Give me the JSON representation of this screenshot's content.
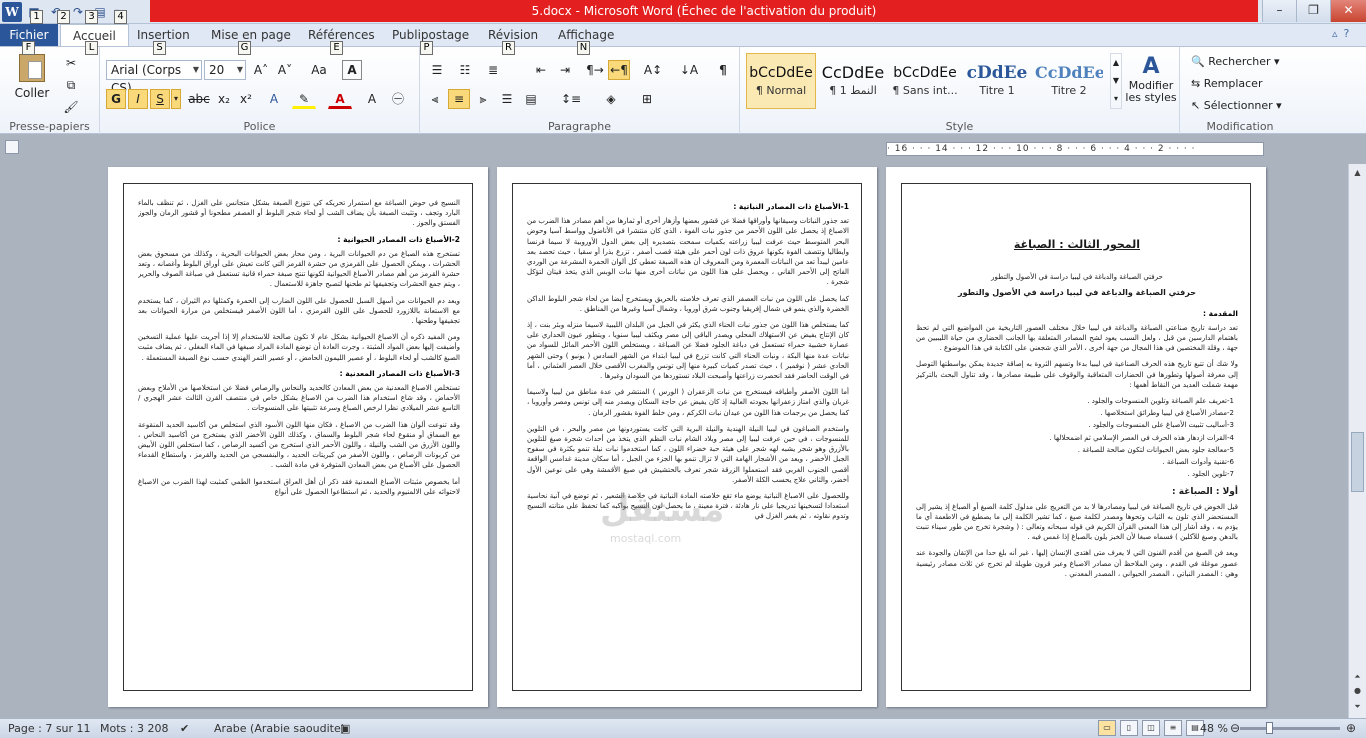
{
  "window": {
    "title": "5.docx  -  Microsoft Word (Échec de l'activation du produit)",
    "qat_keytips": [
      "1",
      "2",
      "3",
      "4"
    ]
  },
  "tabs": {
    "file": "Fichier",
    "items": [
      "Accueil",
      "Insertion",
      "Mise en page",
      "Références",
      "Publipostage",
      "Révision",
      "Affichage"
    ],
    "keytips": [
      "F",
      "L",
      "S",
      "G",
      "E",
      "P",
      "R",
      "N"
    ]
  },
  "ribbon": {
    "clipboard": {
      "label": "Presse-papiers",
      "paste": "Coller"
    },
    "font": {
      "label": "Police",
      "font_name": "Arial (Corps CS)",
      "font_size": "20",
      "bold": "G",
      "italic": "I",
      "underline": "S",
      "strike": "abc",
      "sub": "x₂",
      "sup": "x²",
      "grow": "A˄",
      "shrink": "A˅",
      "case": "Aa",
      "clear": "A"
    },
    "paragraph": {
      "label": "Paragraphe"
    },
    "styles": {
      "label": "Style",
      "items": [
        {
          "preview": "bCcDdEe",
          "name": "¶ Normal"
        },
        {
          "preview": "CcDdEe",
          "name": "¶ النمط 1"
        },
        {
          "preview": "bCcDdEe",
          "name": "¶ Sans int..."
        },
        {
          "preview": "cDdEe",
          "name": "Titre 1"
        },
        {
          "preview": "CcDdEe",
          "name": "Titre 2"
        }
      ],
      "change": "Modifier les styles"
    },
    "editing": {
      "label": "Modification",
      "find": "Rechercher",
      "replace": "Remplacer",
      "select": "Sélectionner"
    }
  },
  "ruler": {
    "ticks": "· 16 · · · 14 · · · 12 · · · 10 · · · 8 · · · 6 · · · 4 · · · 2 · · · ·"
  },
  "pages": {
    "left": {
      "p1": "النسيج في حوض الصباغة مع استمرار تحريكه كي تتوزع الصبغة بشكل متجانس على الغزل ، ثم تنظف بالماء البارد وتجف ، وتثبت الصبغة بأن يضاف الشب أو لحاء شجر البلوط أو العصفر مطحونا أو قشور الرمان والجوز الفستق والجوز .",
      "h1": "2-الأصباغ ذات المصادر الحيوانية :",
      "p2": "تستخرج هذه الصباغ من دم الحيوانات البرية ، ومن محار بعض الحيوانات البحرية ، وكذلك من مسحوق بعض الحشرات ، ويمكن الحصول على القرمزي من حشرة القرمز التي كانت تعيش على أوراق البلوط وأغصانه ، وتعد حشرة القرمز من أهم مصادر الأصباغ الحيوانية لكونها تنتج صبغة حمراء قانية تستعمل في صباغة الصوف والحرير ، ويتم جمع الحشرات وتجفيفها ثم طحنها لتصبح جاهزة للاستعمال .",
      "p3": "ويعد دم الحيوانات من أسهل السبل للحصول على اللون الضارب إلى الحمرة وكمثلها دم الثيران ، كما يستخدم مع الاستعانة باللازورد للحصول على اللون القرمزي ، أما اللون الأصفر فيستخلص من مرارة الحيوانات بعد تجفيفها وطحنها .",
      "p4": "ومن المفيد ذكره أن الاصباغ الحيوانية بشكل عام لا تكون صالحة للاستخدام إلا إذا أجريت عليها عملية التسخين وأضيفت إليها بعض المواد المثبتة ، وجرت العادة أن توضع المادة المراد صبغها في الماء المغلي ، ثم يضاف مثبت الصبغ كالشب أو لحاء البلوط ، أو عصير الليمون الحامض ، أو عصير التمر الهندي حسب نوع الصبغة المستعملة .",
      "h2": "3-الأصباغ ذات المصادر المعدنية :",
      "p5": "تستخلص الاصباغ المعدنية من بعض المعادن كالحديد والنحاس والرصاص فضلا عن استخلاصها من الأملاح وبعض الأحماض ، وقد شاع استخدام هذا الضرب من الاصباغ بشكل خاص في منتصف القرن الثالث عشر الهجري / التاسع عشر الميلادي نظرا لرخص الصباغ وسرعة تثبيتها على المنسوجات .",
      "p6": "وقد تنوعت ألوان هذا الضرب من الاصباغ ، فكان منها اللون الأسود الذي استخلص من أكاسيد الحديد المنقوعة مع السماق أو منقوع لحاء شجر البلوط والسماق ، وكذلك اللون الأخضر الذي يستخرج من أكاسيد النحاس ، واللون الأزرق من الشب والنيلة ، واللون الأحمر الذي استخرج من أكسيد الرصاص ، كما استخلص اللون الأبيض من كربونات الرصاص ، واللون الأصفر من كبريتات الحديد ، والبنفسجي من الحديد والقرمز ، واستطاع القدماء الحصول على الأصباغ من بعض المعادن المتوفرة في مادة الشب .",
      "p7": "أما بخصوص مثبتات الأصباغ المعدنية فقد ذكر أن أهل العراق استخدموا الطمي كمثبت لهذا الضرب من الاصباغ لاحتوائه على الالمنيوم والحديد ، ثم استطاعوا الحصول على أنواع"
    },
    "middle": {
      "h1": "1-الأصباغ ذات المصادر النباتية :",
      "p1": "تعد جذور النباتات وسيقانها وأوراقها فضلا عن قشور بعضها وأزهار أخرى أو ثمارها من أهم مصادر هذا الضرب من الاصباغ إذ يحصل على اللون الأحمر من جذور نبات الفوة ، الذي كان منتشرا في الأناضول وواسط آسيا وحوض البحر المتوسط حيث عرفت ليبيا زراعته بكميات سمحت بتصديره إلى بعض الدول الأوروبية لا سيما فرنسا وايطاليا وتتصف الفوة بكونها عروق ذات لون أحمر على هيئة قصب أصفر ، تزرع بذرا أو سقيا ، حيث تحصد بعد عامين ليبدأ تعد من النباتات المعمرة ومن المعروف أن هذه الصبغة تعطي كل ألوان الحمرة المشرعة من الوردي الفاتح إلى الأحمر القاني ، ويحصل على هذا اللون من نباتات أخرى منها نبات الوبس الذي يتخذ فيتان لتؤكل شجرة .",
      "p2": "كما يحصل على اللون من نبات العصفر الذي تعرف خلاصته بالحريق ويستخرج أيضا من لحاء شجر البلوط الداكن الخضرة والذي ينمو في شمال إفريقيا وجنوب شرق أوروبا ، وشمال آسيا وغيرها من المناطق .",
      "p3": "كما يستخلص هذا اللون من جذور نبات الحناء الذي يكثر في الجبل من البلدان الليبية لاسيما منزله وبئر بنت ، إذ كان الإنتاج يفيض عن الاستهلاك المحلي ويصدر الباقي إلى مصر ويكثف ليبيا سنويا ، ويتطور عيون الحداري على عصارة خشبية حمراء تستعمل في دباغة الجلود فضلا عن الصباغة ، ويستخلص اللون الأحمر المائل للسواد من نباتات عدة منها البكة ، ونبات الحناء التي كانت تزرع في ليبيا ابتداء من الشهر السادس ( يونيو ) وحتى الشهر الحادي عشر ( نوفمبر ) ، حيث تصدر كميات كبيرة منها إلى تونس والمغرب الأقصى خلال العصر العثماني ، أما في الوقت الحاضر فقد انحصرت زراعتها وأصبحت البلاد تستوردها من السودان وغيرها .",
      "p4": "أما اللون الأصفر وأطيافه فيستخرج من نبات الزعفران ( الورس ) المنتشر في عدة مناطق من ليبيا ولاسيما غريان والذي امتاز زعفرانها بجودته العالية إذ كان يفيض عن حاجة السكان ويصدر منه إلى تونس ومصر وأوروبا ، كما يحصل من برجمات هذا اللون من عيدان نبات الكركم ، ومن خلط الفوة بقشور الرمان .",
      "p5": "واستخدم الصباغون في ليبيا النيلة الهندية والنيلة البرية التي كانت يستوردونها من مصر والبحر ، في التلوين للمنسوجات ، في حين عرفت ليبيا إلى مصر وبلاد الشام نبات النظم الذي يتخذ من أحداث شجرة صبغ للتلوين بالأزرق وهو شجر يشبه لهه شجر على هيئة حبة خضراء اللون ، كما استخدموا نبات نيلة تنمو بكثرة في سفوح الجبل الأخضر ، ويعد من الأشجار الهامة التي لا تزال تنمو بها الجزء من الجبل ، أما سكان مدينة غدامس الواقعة أقصى الجنوب الغربي فقد استعملوا الزرقة شجر تعرف بالحتشيش في صبغ الأقمشة وهي على نوعين الأول أخضر، والثاني علاج يحسب الكلة الأصفر.",
      "p6": "وللحصول على الاصباغ النباتية يوضع ماء تقع خلاصته المادة النباتية في خلاصة الشعير ، ثم توضع في آنية نحاسية استعدادا لتسخينها تدريجيا على نار هادئة ، فترة معينة ، ما يحصل لون النسيج بواكبه كما تحفظ على متانته النسيج وتدوم نقاوته ، ثم يغمر الغزل في"
    },
    "right": {
      "title": "المحور الثالث : الصباغة",
      "line1": "حرفتي الصباغة والدباغة في ليبيا دراسة في الأصول والتطور",
      "sub": "حرفتي الصباغة والدباغة في ليبيا دراسة في الأصول والتطور",
      "intro_h": "المقدمة :",
      "p1": "تعد دراسة تاريخ صناعتي الصباغة والدباغة في ليبيا خلال مختلف العصور التاريخية من المواضيع التي لم تحظ باهتمام الدارسين من قبل ، ولعل السبب يعود لشح المصادر المتعلقة بها الجانب الحضاري من حياة الليبيين من جهة ، وقلة المختصين في هذا المجال من جهة أخرى ، الأمر الذي شجعني على الكتابة في هذا الموضوع .",
      "p2": "ولا شك أن تتبع تاريخ هذه الحرف الصناعية في ليبيا بدءا وتسهم الثروة به إصاقة جديدة يمكن بواسطتها التوصل إلى معرفة أصولها وتطورها في الحضارات المتعاقبة والوقوف على طبيعة مصادرها ، وقد تناول البحث بالتركيز مهمة شملت العديد من النقاط أهمها :",
      "list": [
        "1-تعريف علم الصباغة وتلوين المنسوجات والجلود .",
        "2-مصادر الأصباغ في ليبيا وطرائق استخلاصها .",
        "3-أساليب تثبيت الأصباغ على المنسوجات والجلود .",
        "4-القرات ازدهار هذه الحرف في العصر الإسلامي ثم اضمحلالها .",
        "5-معالجة جلود بعض الحيوانات لتكون صالحة للصباغة .",
        "6-تقنية وأدوات الصباغة .",
        "7-تلوين الجلود ."
      ],
      "h1": "أولا : الصباغة :",
      "p3": "قبل الخوض في تاريخ الصباغة في ليبيا ومصادرها لا بد من التعريج على مدلول كلمة الصبغ أو الصباغ إذ يشير إلى المستحضر الذي تلون به الثياب وتحوها ومصدر لكلمة صبغ ، كما تشير الكلمة إلى ما يصطبغ في الاطعمة أي ما يؤدم به ، وقد أشار إلى هذا المعنى القرآن الكريم في قوله سبحانه وتعالى : ( وشجرة تخرج من طور سيناء تنبت بالدهن وصبغ للآكلين ) فسماه صبغا لأن الخبز يلون بالصباغ إذا غمس فيه .",
      "p4": "ويعد فن الصبغ من أقدم الفنون التي لا يعرف متى اهتدى الإنسان إليها ، غير أنه بلغ حدا من الإتقان والجودة عند عصور موغلة في القدم ، ومن الملاحظ أن مصادر الاصباغ وعبر قرون طويلة لم تخرج عن ثلاث مصادر رئيسية وهي : المصدر النباتي ، المصدر الحيواني ، المصدر المعدني ."
    }
  },
  "watermark": {
    "text": "مستقل",
    "url": "mostaql.com"
  },
  "statusbar": {
    "page": "Page : 7 sur 11",
    "words": "Mots : 3 208",
    "lang": "Arabe (Arabie saoudite)",
    "zoom": "48 %"
  }
}
